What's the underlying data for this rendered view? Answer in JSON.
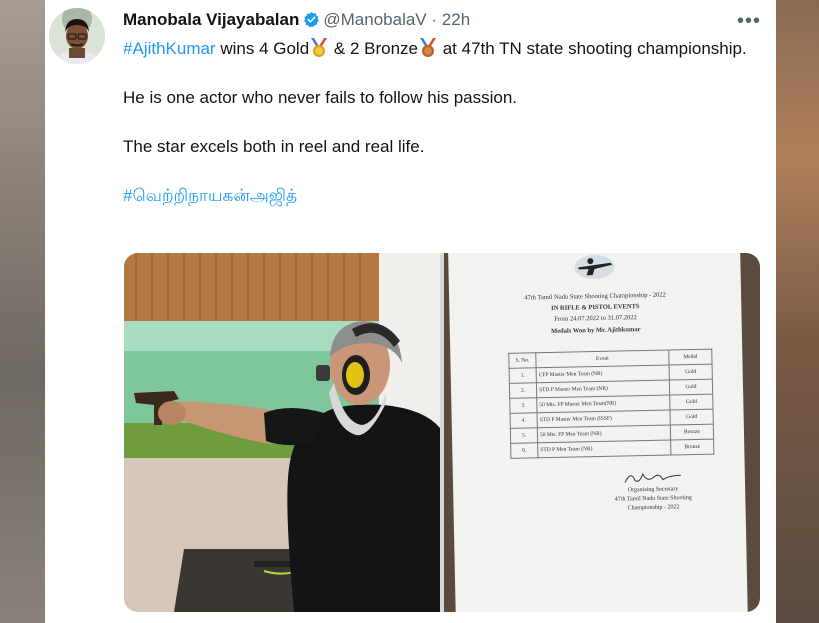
{
  "tweet": {
    "author_name": "Manobala Vijayabalan",
    "handle": "@ManobalaV",
    "separator": "·",
    "time": "22h",
    "more": "•••",
    "hashtag_main": "#AjithKumar",
    "line1_a": " wins 4 Gold",
    "line1_b": " & 2 Bronze",
    "line1_c": " at 47th TN state shooting championship.",
    "para2": "He is one actor who never fails to follow his passion.",
    "para3": "The star excels both in reel and real life.",
    "hashtag_tamil": "#வெற்றிநாயகன்அஜித்"
  },
  "certificate": {
    "title_line": "47th Tamil Nadu State Shooting Championship - 2022",
    "events_line": "IN RIFLE & PISTOL EVENTS",
    "dates_line": "From 24.07.2022 to 31.07.2022",
    "medals_line": "Medals Won by Mr. Ajithkumar",
    "headers": [
      "S. No.",
      "Event",
      "Medal"
    ],
    "rows": [
      [
        "1.",
        "CFP Master Men Team (NR)",
        "Gold"
      ],
      [
        "2.",
        "STD P Master Men Team (NR)",
        "Gold"
      ],
      [
        "3.",
        "50 Mts. FP Master Men Team(NR)",
        "Gold"
      ],
      [
        "4.",
        "STD P Master Men Team (ISSF)",
        "Gold"
      ],
      [
        "5.",
        "50 Mts. FP Men Team (NR)",
        "Bronze"
      ],
      [
        "6.",
        "STD P Men Team (NR)",
        "Bronze"
      ]
    ],
    "sig_1": "Organising Secretary",
    "sig_2": "47th Tamil Nadu State Shooting",
    "sig_3": "Championship - 2022"
  },
  "colors": {
    "link": "#1d9bf0",
    "text": "#0f1419",
    "muted": "#536471",
    "verified": "#1d9bf0",
    "medal_gold": "#e8a317",
    "medal_bronze": "#c8752e"
  }
}
